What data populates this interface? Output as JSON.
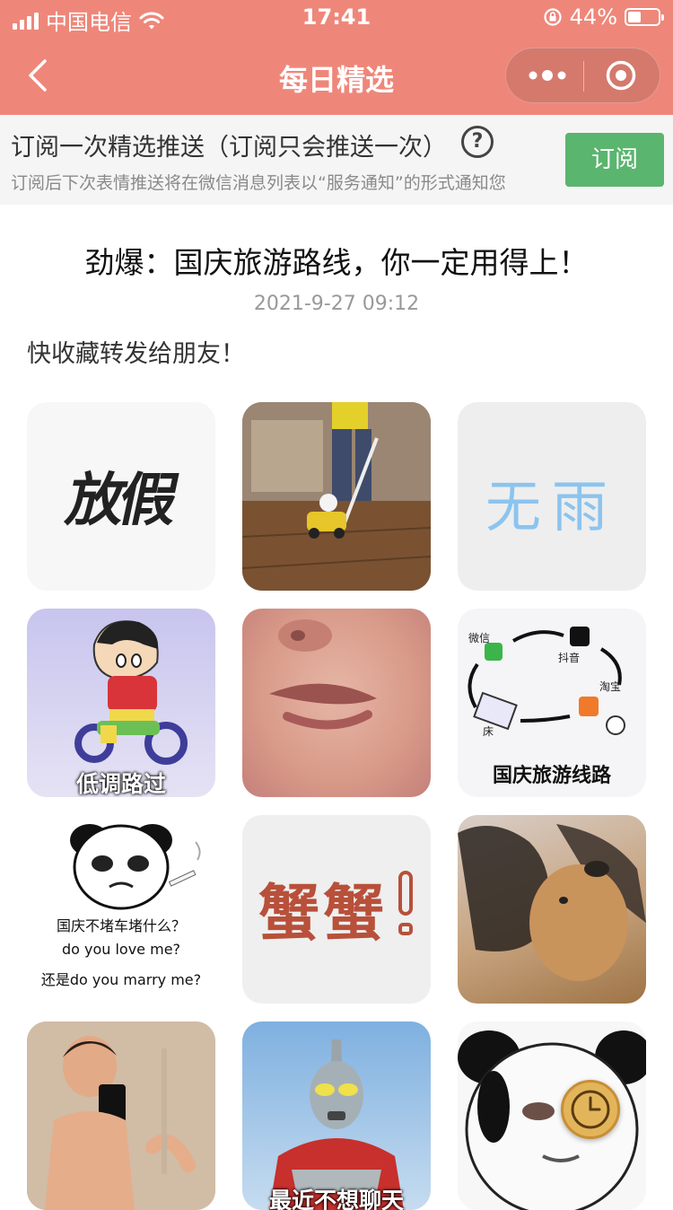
{
  "status_bar": {
    "carrier": "中国电信",
    "time": "17:41",
    "battery": "44%",
    "battery_level": 0.44
  },
  "nav": {
    "title": "每日精选",
    "back_icon": "back-arrow-icon",
    "more_icon": "more-dots-icon",
    "close_icon": "target-close-icon"
  },
  "subscribe": {
    "title": "订阅一次精选推送（订阅只会推送一次）",
    "help_glyph": "?",
    "description": "订阅后下次表情推送将在微信消息列表以“服务通知”的形式通知您",
    "button": "订阅",
    "button_color": "#5ab56e"
  },
  "article": {
    "title": "劲爆：国庆旅游路线，你一定用得上！",
    "date": "2021-9-27 09:12",
    "intro": "快收藏转发给朋友！"
  },
  "stickers": [
    {
      "name": "sticker-text-fangjia",
      "text": "放假"
    },
    {
      "name": "sticker-kid-toy-car"
    },
    {
      "name": "sticker-text-wuyu",
      "text": "无雨"
    },
    {
      "name": "sticker-shinchan-tricycle",
      "caption": "低调路过"
    },
    {
      "name": "sticker-baby-crying"
    },
    {
      "name": "sticker-holiday-route",
      "labels": [
        "微信",
        "抖音",
        "淘宝",
        "床"
      ],
      "caption": "国庆旅游线路"
    },
    {
      "name": "sticker-panda-smoking",
      "lines": [
        "国庆不堵车堵什么？",
        "do you love me?",
        "还是do you marry me?"
      ]
    },
    {
      "name": "sticker-text-xiexie",
      "text": "蟹蟹"
    },
    {
      "name": "sticker-dog-hair"
    },
    {
      "name": "sticker-kid-selfie"
    },
    {
      "name": "sticker-ultraman",
      "caption": "最近不想聊天"
    },
    {
      "name": "sticker-panda-face"
    }
  ],
  "floating": {
    "icon": "clock-icon"
  },
  "colors": {
    "header": "#ee877a",
    "banner_bg": "#f5f5f5",
    "date_text": "#999999"
  }
}
